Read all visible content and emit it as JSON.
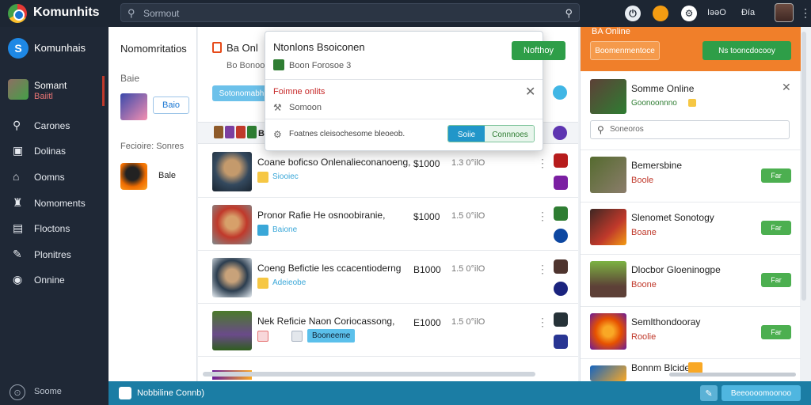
{
  "topbar": {
    "app_title": "Komunhits",
    "search_placeholder": "Sormout",
    "lang_label": "IəəO",
    "tools_label": "Ðía"
  },
  "sidebar": {
    "brand": "Komunhais",
    "user": {
      "name": "Somant",
      "sub": "Baiitl"
    },
    "items": [
      {
        "label": "Carones",
        "icon": "search-icon"
      },
      {
        "label": "Dolinas",
        "icon": "monitor-icon"
      },
      {
        "label": "Oomns",
        "icon": "home-icon"
      },
      {
        "label": "Nomoments",
        "icon": "building-icon"
      },
      {
        "label": "Floctons",
        "icon": "document-icon"
      },
      {
        "label": "Plonitres",
        "icon": "notes-icon"
      },
      {
        "label": "Onnine",
        "icon": "globe-icon"
      }
    ],
    "footer": "Soome"
  },
  "left_panel": {
    "title": "Nomomritatios",
    "section1": "Baie",
    "button1": "Baio",
    "section2": "Fecioire: Sonres",
    "item2_label": "Bale"
  },
  "center": {
    "header": "Ba Onl",
    "subheader": "Bo   Bonoo",
    "tab_label": "Sotonomabh",
    "strip_label": "BE",
    "rows": [
      {
        "title": "Coane boficso Onlenalieconanoeng,",
        "sub": "Siooiec",
        "price": "$1000",
        "meta": "1.3 0°ilO"
      },
      {
        "title": "Pronor Rafie He osnoobiranie,",
        "sub": "Baione",
        "price": "$1000",
        "meta": "1.5 0°ilO"
      },
      {
        "title": "Coeng Befictie les ccacentioderng",
        "sub": "Adeieobe",
        "price": "B1000",
        "meta": "1.5 0°ilO"
      },
      {
        "title": "Nek Reficie Naon Coriocassong,",
        "sub": "Booneeme",
        "price": "E1000",
        "meta": "1.5 0°ilO"
      }
    ]
  },
  "popup": {
    "title": "Ntonlons Bsoiconen",
    "primary_button": "Nofthoy",
    "subtitle": "Boon Forosoe 3",
    "section": "Foimne onlits",
    "field": "Somoon",
    "footer_text": "Foatnes cleisochesome bleoeob.",
    "seg_a": "Soiie",
    "seg_b": "Connnoes"
  },
  "right_panel": {
    "top_label": "BA Online",
    "button_left": "Boomenmentoce",
    "button_right": "Ns tooncdocooy",
    "card": {
      "title": "Somme Online",
      "sub": "Goonoonnno"
    },
    "search_placeholder": "Soneoros",
    "items": [
      {
        "title": "Bemersbine",
        "sub": "Boole",
        "button": "Far"
      },
      {
        "title": "Slenomet Sonotogy",
        "sub": "Boane",
        "button": "Far"
      },
      {
        "title": "Dlocbor Gloeninogpe",
        "sub": "Boone",
        "button": "Far"
      },
      {
        "title": "Semlthondooray",
        "sub": "Roolie",
        "button": "Far"
      },
      {
        "title": "Bonnm Blcides",
        "sub": "",
        "button": ""
      }
    ]
  },
  "bottombar": {
    "label": "Nobbiline Connb)",
    "button": "Beeoooomoonoo"
  }
}
